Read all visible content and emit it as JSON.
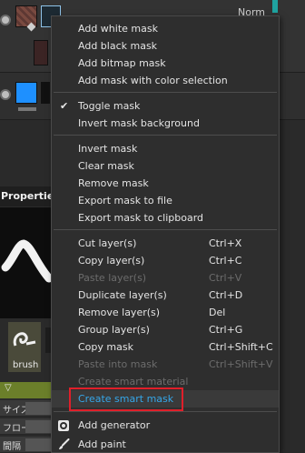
{
  "layers": {
    "blend_mode": "Norm"
  },
  "properties": {
    "panel_title": "Properties",
    "brush_label": "brush",
    "rows": [
      {
        "label": "サイズ"
      },
      {
        "label": "フロー"
      },
      {
        "label": "間隔"
      }
    ]
  },
  "menu": {
    "items": [
      {
        "label": "Add white mask",
        "shortcut": ""
      },
      {
        "label": "Add black mask",
        "shortcut": ""
      },
      {
        "label": "Add bitmap mask",
        "shortcut": ""
      },
      {
        "label": "Add mask with color selection",
        "shortcut": ""
      },
      {
        "label": "Toggle mask",
        "shortcut": "",
        "checked": true
      },
      {
        "label": "Invert mask background",
        "shortcut": ""
      },
      {
        "label": "Invert mask",
        "shortcut": ""
      },
      {
        "label": "Clear mask",
        "shortcut": ""
      },
      {
        "label": "Remove mask",
        "shortcut": ""
      },
      {
        "label": "Export mask to file",
        "shortcut": ""
      },
      {
        "label": "Export mask to clipboard",
        "shortcut": ""
      },
      {
        "label": "Cut layer(s)",
        "shortcut": "Ctrl+X"
      },
      {
        "label": "Copy layer(s)",
        "shortcut": "Ctrl+C"
      },
      {
        "label": "Paste layer(s)",
        "shortcut": "Ctrl+V",
        "disabled": true
      },
      {
        "label": "Duplicate layer(s)",
        "shortcut": "Ctrl+D"
      },
      {
        "label": "Remove layer(s)",
        "shortcut": "Del"
      },
      {
        "label": "Group layer(s)",
        "shortcut": "Ctrl+G"
      },
      {
        "label": "Copy mask",
        "shortcut": "Ctrl+Shift+C"
      },
      {
        "label": "Paste into mask",
        "shortcut": "Ctrl+Shift+V",
        "disabled": true
      },
      {
        "label": "Create smart material",
        "shortcut": "",
        "disabled": true
      },
      {
        "label": "Create smart mask",
        "shortcut": "",
        "highlighted": true
      },
      {
        "label": "Add generator",
        "shortcut": "",
        "icon": "generator-icon"
      },
      {
        "label": "Add paint",
        "shortcut": "",
        "icon": "paint-brush-icon"
      }
    ]
  },
  "colors": {
    "highlight_text": "#35a6e8",
    "highlight_border": "#e01f2a",
    "layer_thumb_blue": "#1e90ff"
  }
}
